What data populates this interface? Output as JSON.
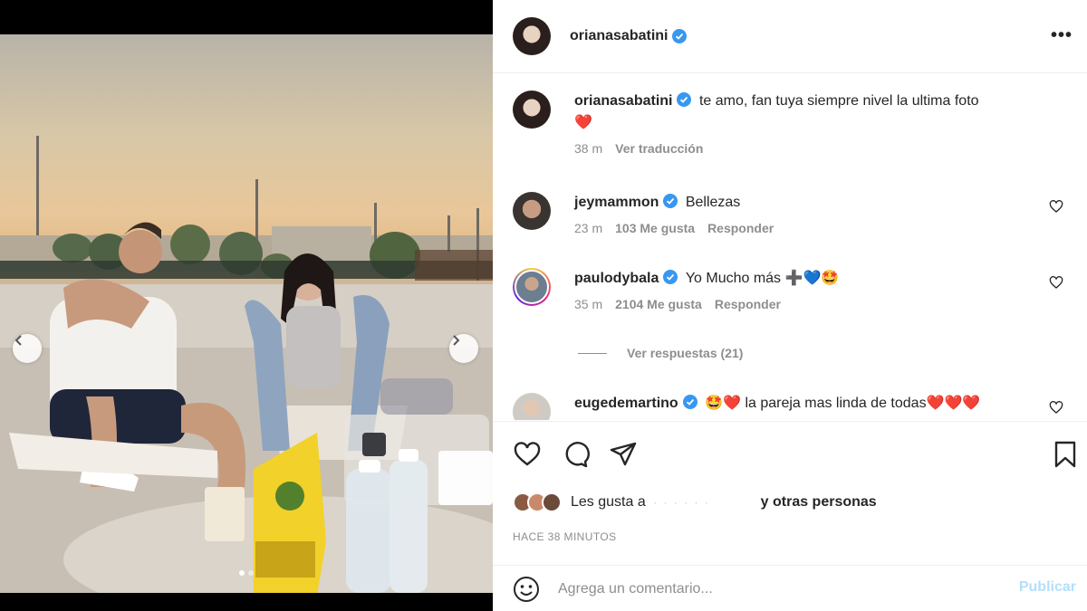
{
  "post": {
    "author": "orianasabatini",
    "verified": true,
    "more_icon": "more-horizontal-icon"
  },
  "caption": {
    "author": "orianasabatini",
    "text": "te amo, fan tuya siempre nivel la ultima foto",
    "emoji": "❤️",
    "time": "38 m",
    "translate": "Ver traducción"
  },
  "comments": [
    {
      "user": "jeymammon",
      "text": "Bellezas",
      "time": "23 m",
      "likes": "103 Me gusta",
      "reply": "Responder"
    },
    {
      "user": "paulodybala",
      "text": "Yo Mucho más",
      "emoji": "➕💙🤩",
      "time": "35 m",
      "likes": "2104 Me gusta",
      "reply": "Responder"
    },
    {
      "user": "eugedemartino",
      "emoji_pre": "🤩❤️",
      "text": "la pareja mas linda de todas",
      "emoji": "❤️❤️❤️"
    }
  ],
  "view_replies": "Ver respuestas (21)",
  "likes": {
    "prefix": "Les gusta a",
    "hidden_user": "· · ·   ·   ·  ·",
    "suffix": "y otras personas"
  },
  "timestamp": "HACE 38 MINUTOS",
  "composer": {
    "placeholder": "Agrega un comentario...",
    "publish": "Publicar"
  },
  "colors": {
    "verified": "#3897f0",
    "publish_disabled": "#b2dffc",
    "secondary_text": "#8e8e8e"
  }
}
